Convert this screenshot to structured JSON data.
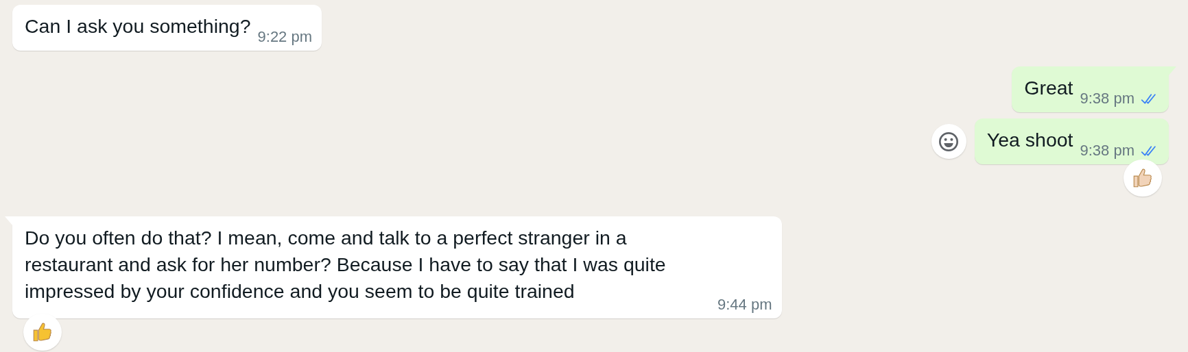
{
  "messages": [
    {
      "outgoing": false,
      "text": "Can I ask you something?",
      "time": "9:22 pm",
      "tail": false
    },
    {
      "outgoing": true,
      "text": "Great",
      "time": "9:38 pm",
      "read": true,
      "tail": true
    },
    {
      "outgoing": true,
      "text": "Yea shoot",
      "time": "9:38 pm",
      "read": true,
      "tail": false,
      "react_button": true,
      "reaction": {
        "color": "#f1d3b9"
      }
    },
    {
      "outgoing": false,
      "text": "Do you often do that? I mean, come and talk to a perfect stranger in a restaurant and ask for her number? Because I have to say that I was quite impressed by your confidence and you seem to be quite trained",
      "time": "9:44 pm",
      "tail": true,
      "reaction": {
        "color": "#f6c232"
      }
    }
  ]
}
